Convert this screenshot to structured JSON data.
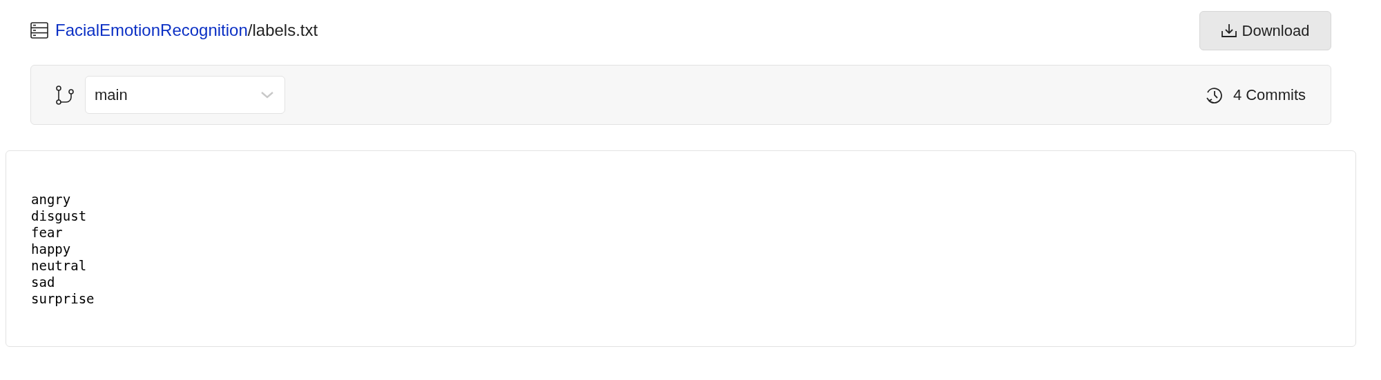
{
  "breadcrumb": {
    "repo": "FacialEmotionRecognition",
    "separator": "/",
    "file": "labels.txt"
  },
  "download_button": {
    "label": "Download"
  },
  "branch_select": {
    "value": "main"
  },
  "commits": {
    "label": "4 Commits"
  },
  "file_lines": [
    "angry",
    "disgust",
    "fear",
    "happy",
    "neutral",
    "sad",
    "surprise"
  ]
}
